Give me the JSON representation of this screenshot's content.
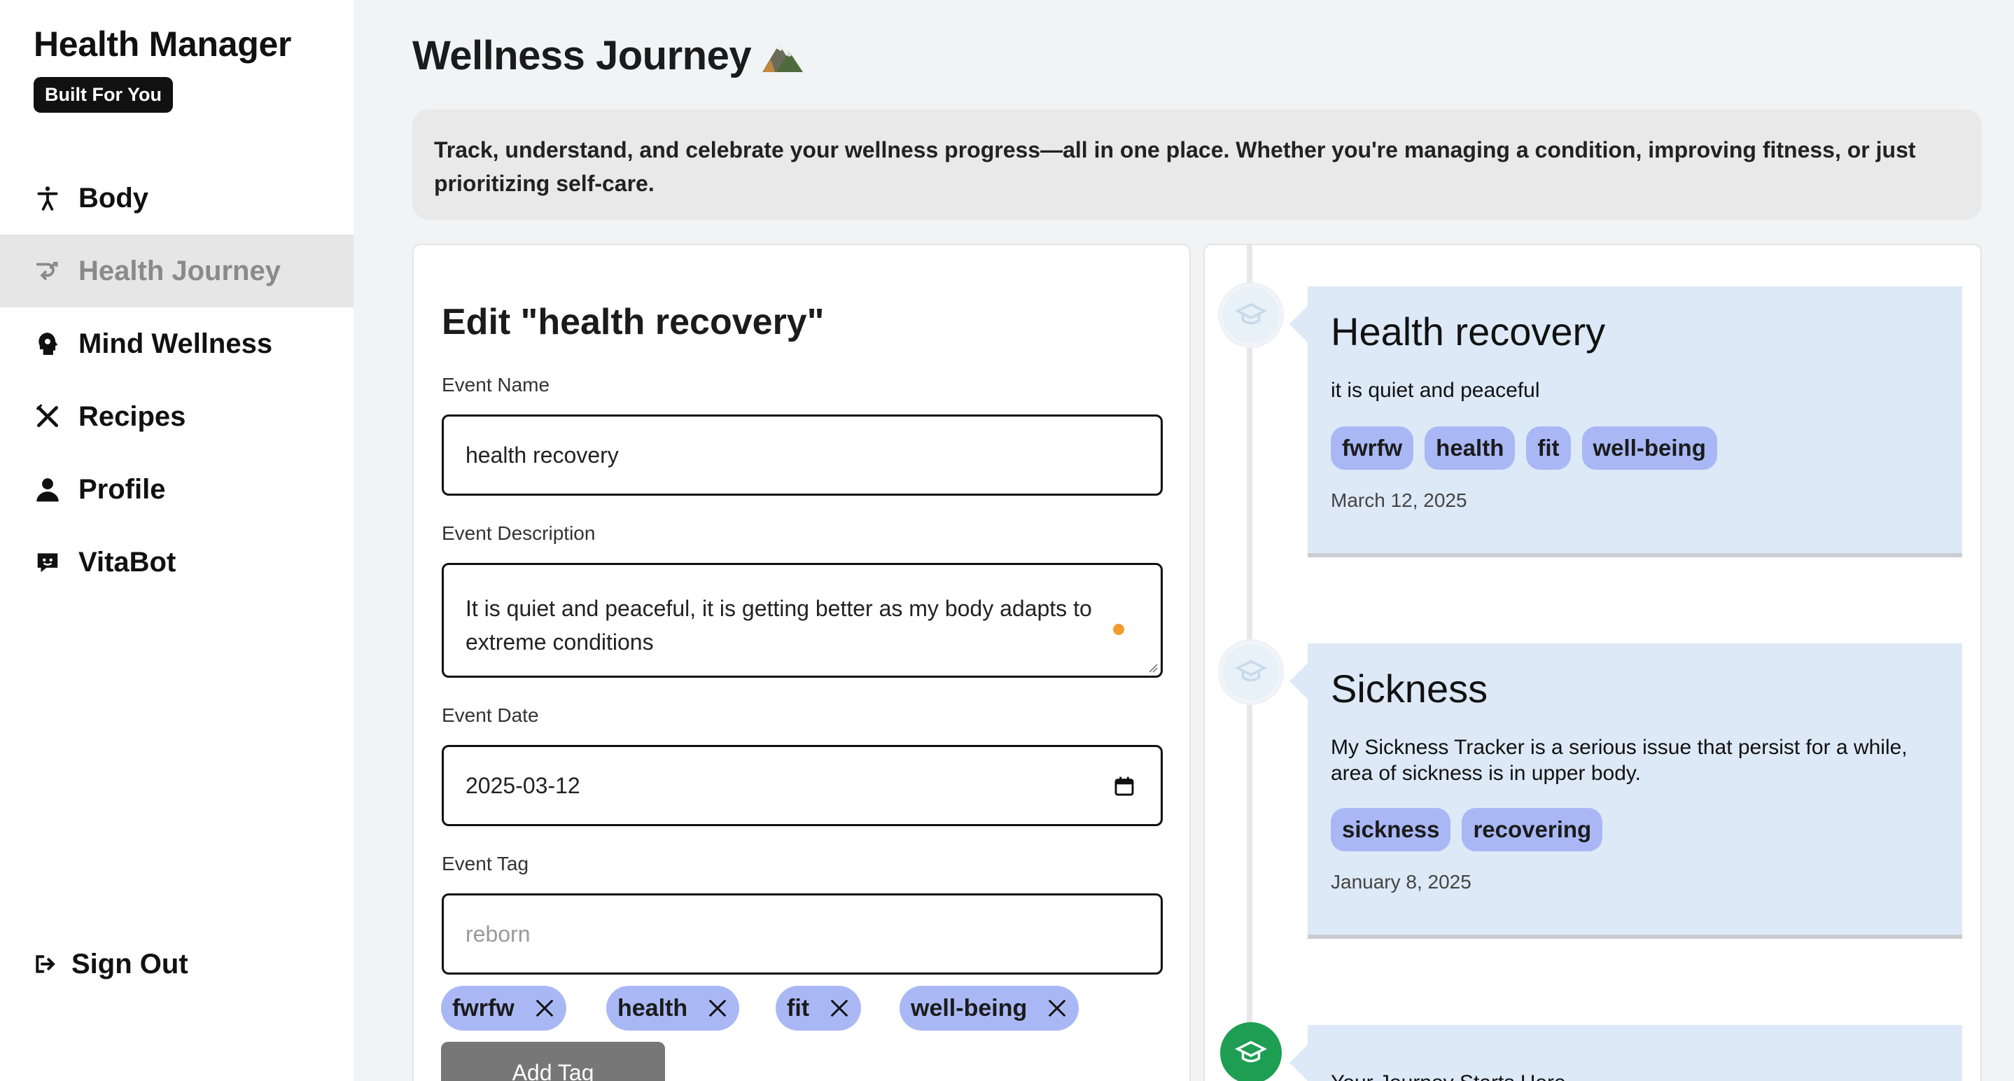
{
  "app": {
    "title": "Health Manager",
    "badge": "Built For You"
  },
  "sidebar": {
    "items": [
      {
        "label": "Body",
        "icon": "person-icon"
      },
      {
        "label": "Health Journey",
        "icon": "journey-icon",
        "active": true
      },
      {
        "label": "Mind Wellness",
        "icon": "head-icon"
      },
      {
        "label": "Recipes",
        "icon": "utensils-icon"
      },
      {
        "label": "Profile",
        "icon": "user-icon"
      },
      {
        "label": "VitaBot",
        "icon": "chat-bot-icon"
      }
    ],
    "sign_out": "Sign Out"
  },
  "page": {
    "title": "Wellness Journey",
    "title_icon": "mountain-icon",
    "intro": "Track, understand, and celebrate your wellness progress—all in one place. Whether you're managing a condition, improving fitness, or just prioritizing self-care."
  },
  "form": {
    "title": "Edit \"health recovery\"",
    "name_label": "Event Name",
    "name_value": "health recovery",
    "desc_label": "Event Description",
    "desc_value": "It is quiet and peaceful, it is getting better as my body adapts to extreme conditions",
    "date_label": "Event Date",
    "date_value": "2025-03-12",
    "tag_label": "Event Tag",
    "tag_placeholder": "reborn",
    "tags": [
      "fwrfw",
      "health",
      "fit",
      "well-being"
    ],
    "add_tag_label": "Add Tag"
  },
  "timeline": {
    "events": [
      {
        "title": "Health recovery",
        "description": "it is quiet and peaceful",
        "tags": [
          "fwrfw",
          "health",
          "fit",
          "well-being"
        ],
        "date": "March 12, 2025"
      },
      {
        "title": "Sickness",
        "description": "My Sickness Tracker is a serious issue that persist for a while, area of sickness is in upper body.",
        "tags": [
          "sickness",
          "recovering"
        ],
        "date": "January 8, 2025"
      },
      {
        "title": "Your Journey Starts Here"
      }
    ]
  },
  "colors": {
    "tag": "#a9b8f5",
    "timeline_card": "#dde9f6",
    "start_node": "#1e9e53",
    "active_nav": "#e6e6e6",
    "focus_dot": "#f39c2a"
  }
}
